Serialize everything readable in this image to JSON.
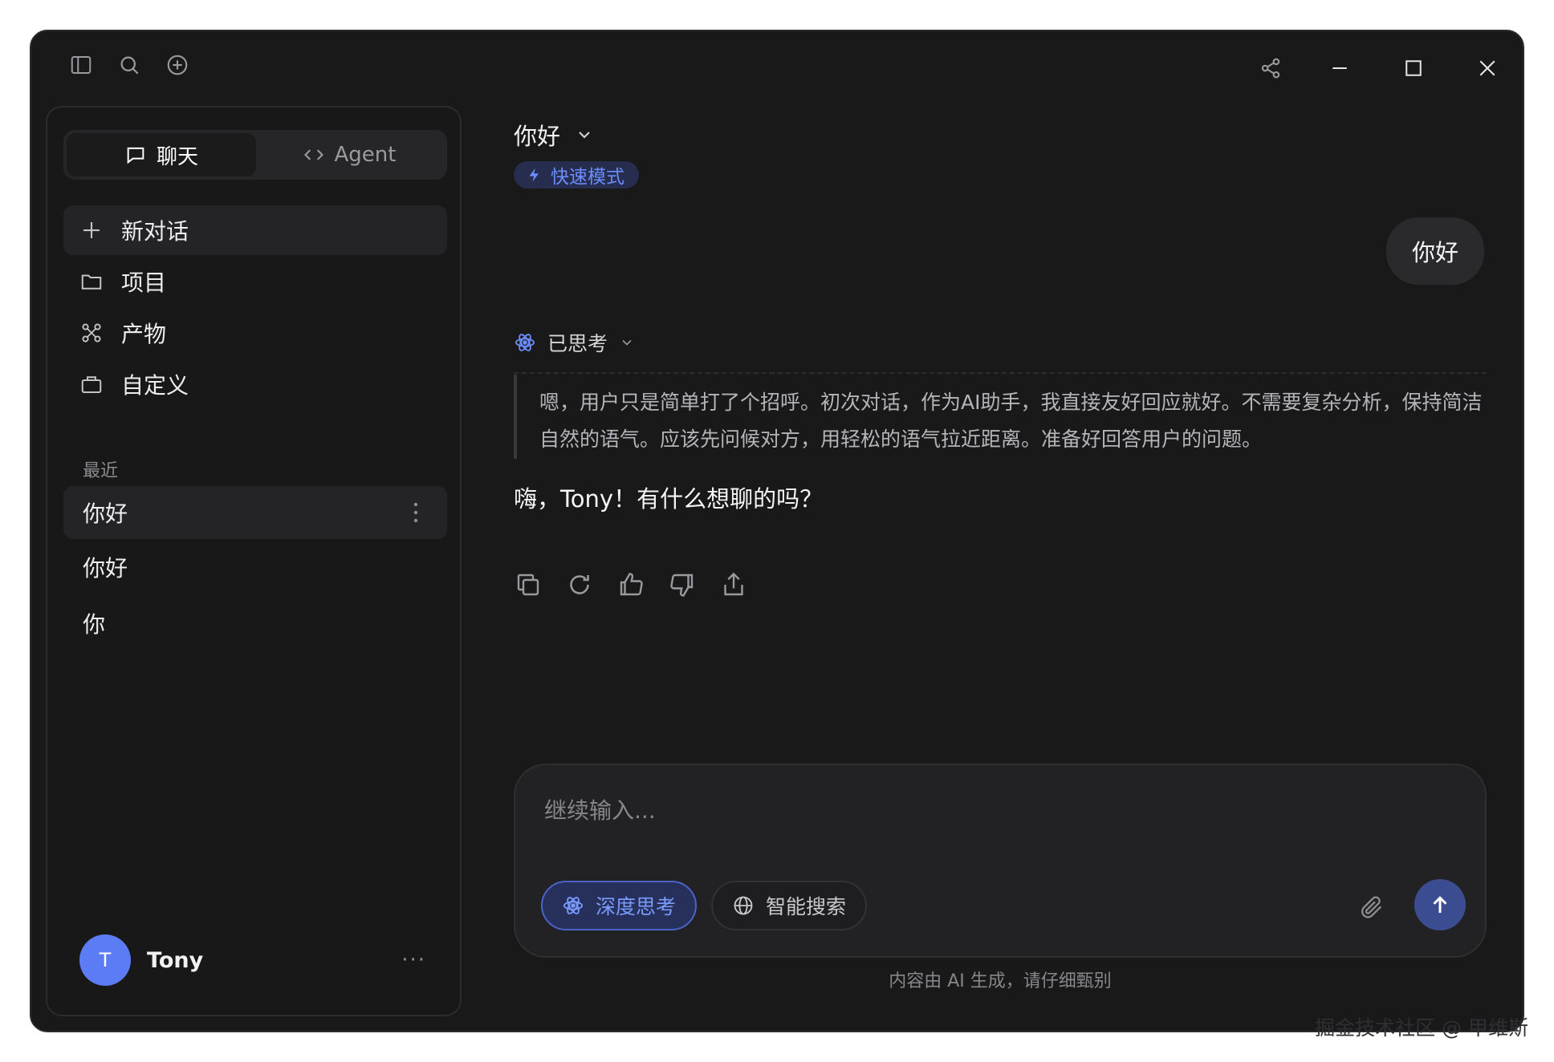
{
  "sidebar": {
    "tabs": [
      {
        "label": "聊天",
        "icon": "chat-bubble-icon",
        "active": true
      },
      {
        "label": "Agent",
        "icon": "code-icon",
        "active": false
      }
    ],
    "nav": [
      {
        "label": "新对话",
        "icon": "plus-icon"
      },
      {
        "label": "项目",
        "icon": "folder-icon"
      },
      {
        "label": "产物",
        "icon": "command-icon"
      },
      {
        "label": "自定义",
        "icon": "bag-icon"
      }
    ],
    "recent_label": "最近",
    "recent": [
      {
        "label": "你好",
        "selected": true
      },
      {
        "label": "你好",
        "selected": false
      },
      {
        "label": "你",
        "selected": false
      }
    ],
    "user": {
      "initial": "T",
      "name": "Tony",
      "more": "···"
    }
  },
  "conversation": {
    "title": "你好",
    "mode_badge": "快速模式",
    "user_message": "你好",
    "thinking_label": "已思考",
    "thinking_text": "嗯，用户只是简单打了个招呼。初次对话，作为AI助手，我直接友好回应就好。不需要复杂分析，保持简洁自然的语气。应该先问候对方，用轻松的语气拉近距离。准备好回答用户的问题。",
    "answer": "嗨，Tony！有什么想聊的吗？"
  },
  "composer": {
    "placeholder": "继续输入...",
    "deep_think": "深度思考",
    "smart_search": "智能搜索"
  },
  "disclaimer": "内容由 AI 生成，请仔细甄别",
  "watermark": "掘金技术社区 @ 甲维斯",
  "colors": {
    "window_bg": "#191919",
    "accent": "#6c8dff",
    "avatar": "#5b7cf4",
    "send_button": "#3c4c91"
  }
}
